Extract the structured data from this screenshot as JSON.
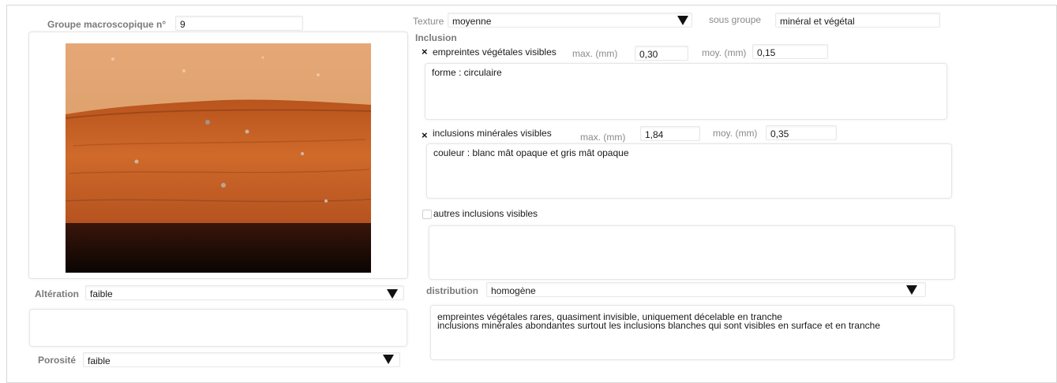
{
  "groupe": {
    "label": "Groupe macroscopique n°",
    "value": "9"
  },
  "texture": {
    "label": "Texture",
    "value": "moyenne",
    "dropdown_icon": "triangle-down"
  },
  "sous_groupe": {
    "label": "sous groupe",
    "value": "minéral et végétal"
  },
  "inclusion_heading": "Inclusion",
  "empreintes": {
    "check": "×",
    "label": "empreintes végétales visibles",
    "max_label": "max. (mm)",
    "max_value": "0,30",
    "moy_label": "moy. (mm)",
    "moy_value": "0,15",
    "note": "forme : circulaire"
  },
  "mineral": {
    "check": "×",
    "label": "inclusions minérales visibles",
    "max_label": "max. (mm)",
    "max_value": "1,84",
    "moy_label": "moy. (mm)",
    "moy_value": "0,35",
    "note": "couleur : blanc mât opaque et gris mât opaque"
  },
  "autres": {
    "label": "autres inclusions visibles",
    "note": ""
  },
  "distribution": {
    "label": "distribution",
    "value": "homogène",
    "note": "empreintes végétales rares, quasiment invisible, uniquement décelable en tranche\ninclusions minérales abondantes surtout les inclusions blanches qui sont visibles en surface et en tranche"
  },
  "alteration": {
    "label": "Altération",
    "value": "faible",
    "note": ""
  },
  "porosite": {
    "label": "Porosité",
    "value": "faible"
  },
  "colors": {
    "label_gray": "#8a8a8a",
    "border": "#e6e6e6",
    "ceramic_orange": "#c8662a"
  }
}
